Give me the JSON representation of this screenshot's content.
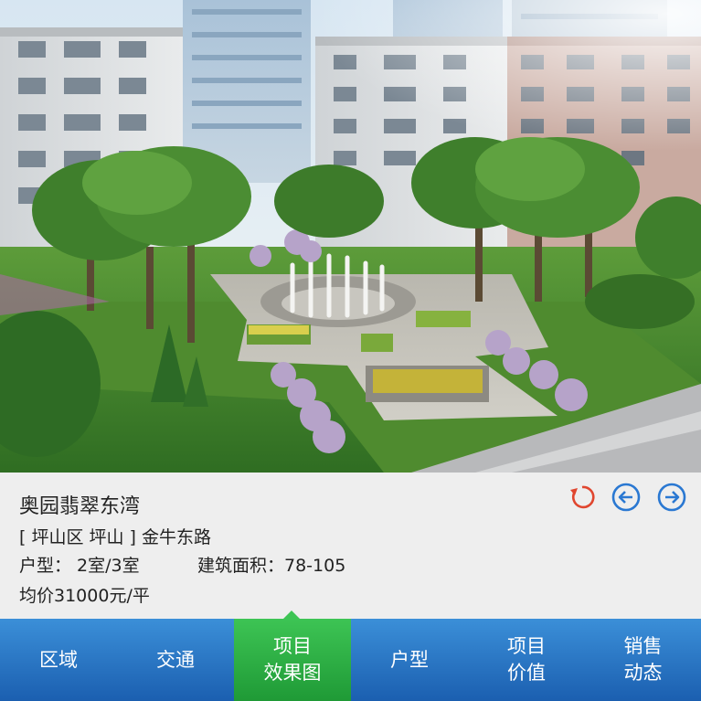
{
  "project": {
    "title": "奥园翡翠东湾",
    "address": "[ 坪山区 坪山 ] 金牛东路",
    "unit_type": "户型： 2室/3室",
    "floor_area": "建筑面积：78-105",
    "price": "均价31000元/平"
  },
  "actions": {
    "refresh_icon": "refresh-icon",
    "prev_icon": "arrow-left-circle-icon",
    "next_icon": "arrow-right-circle-icon",
    "refresh_color": "#e0462f",
    "nav_color": "#2a78d2"
  },
  "tabs": [
    {
      "line1": "区域",
      "line2": ""
    },
    {
      "line1": "交通",
      "line2": ""
    },
    {
      "line1": "项目",
      "line2": "效果图"
    },
    {
      "line1": "户型",
      "line2": ""
    },
    {
      "line1": "项目",
      "line2": "价值"
    },
    {
      "line1": "销售",
      "line2": "动态"
    }
  ],
  "active_tab_index": 2,
  "colors": {
    "tab_bar": "#2574c6",
    "tab_active": "#2fb046",
    "info_bg": "#eeeeee"
  }
}
